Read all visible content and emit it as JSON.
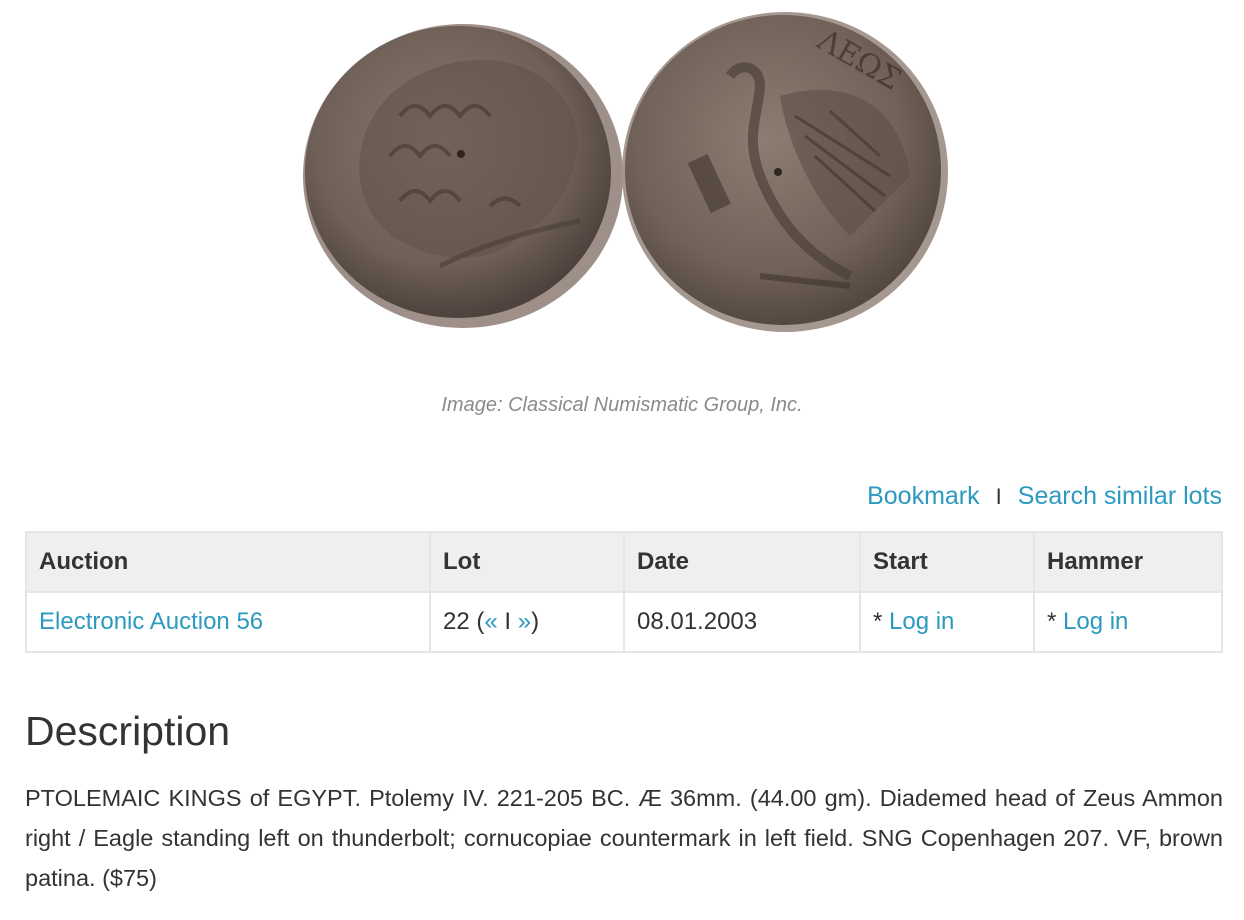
{
  "image": {
    "alt": "Coin obverse and reverse",
    "caption": "Image: Classical Numismatic Group, Inc."
  },
  "actions": {
    "bookmark": "Bookmark",
    "separator": "I",
    "search_similar": "Search similar lots"
  },
  "table": {
    "headers": {
      "auction": "Auction",
      "lot": "Lot",
      "date": "Date",
      "start": "Start",
      "hammer": "Hammer"
    },
    "row": {
      "auction": "Electronic Auction 56",
      "lot_number": "22",
      "lot_open": " (",
      "prev": "«",
      "nav_sep": " I ",
      "next": "»",
      "lot_close": ")",
      "date": "08.01.2003",
      "start_prefix": "* ",
      "start_link": "Log in",
      "hammer_prefix": "* ",
      "hammer_link": "Log in"
    }
  },
  "description": {
    "title": "Description",
    "text": "PTOLEMAIC KINGS of EGYPT. Ptolemy IV. 221-205 BC. Æ 36mm. (44.00 gm). Diademed head of Zeus Ammon right / Eagle standing left on thunderbolt; cornucopiae countermark in left field. SNG Copenhagen 207. VF, brown patina. ($75)"
  },
  "colors": {
    "link": "#2c9ac0",
    "text": "#333333",
    "caption": "#8a8a8a",
    "header_bg": "#efefef",
    "border": "#e6e6e6"
  }
}
